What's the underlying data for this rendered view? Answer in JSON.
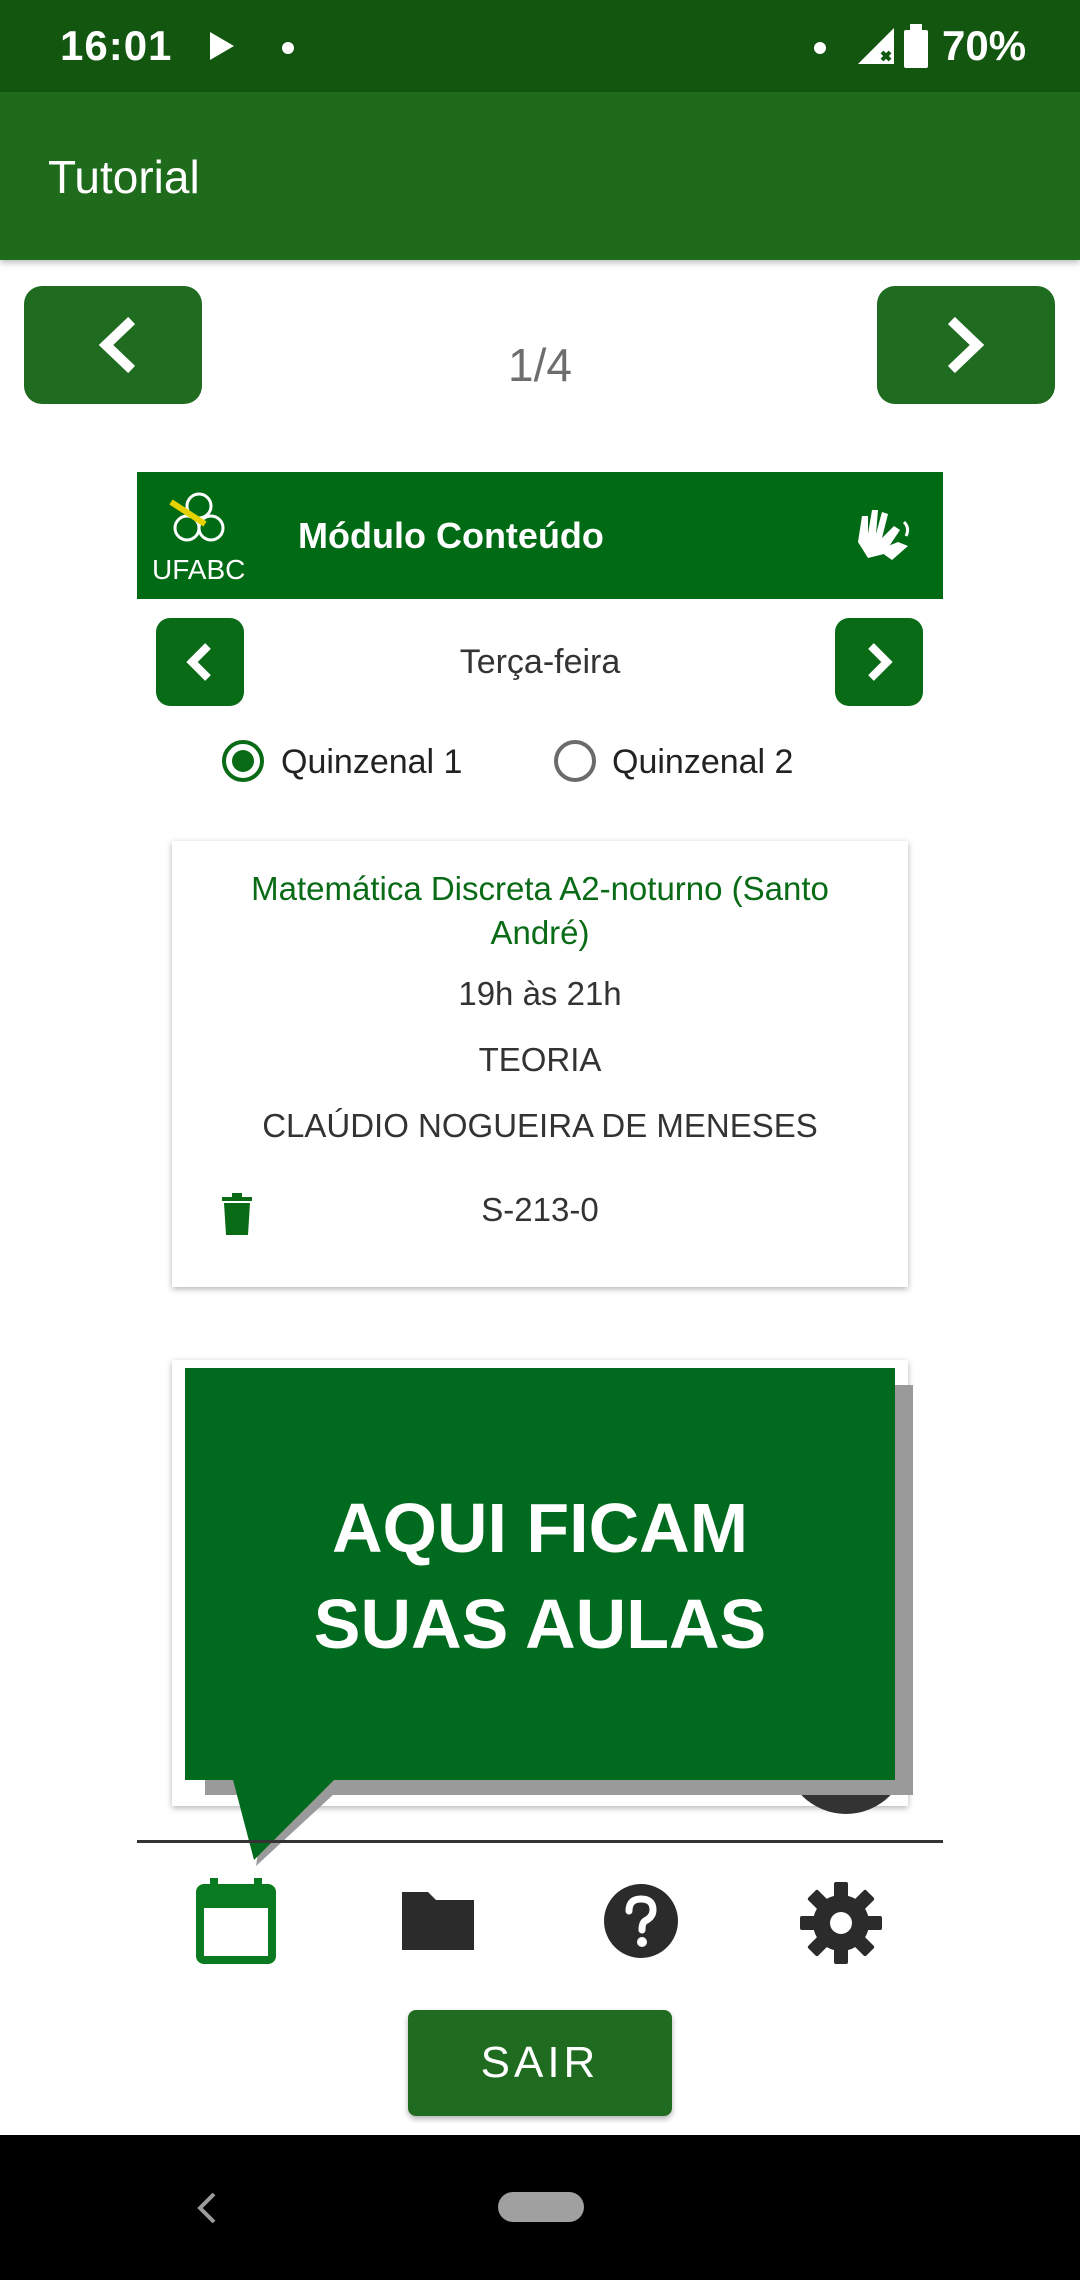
{
  "status_bar": {
    "time": "16:01",
    "battery": "70%"
  },
  "app_bar": {
    "title": "Tutorial"
  },
  "tutorial": {
    "page_counter": "1/4"
  },
  "module": {
    "logo_text": "UFABC",
    "title": "Módulo Conteúdo"
  },
  "day_selector": {
    "label": "Terça-feira"
  },
  "frequency": {
    "option1": "Quinzenal 1",
    "option2": "Quinzenal 2",
    "selected": "Quinzenal 1"
  },
  "class_card": {
    "title": "Matemática Discreta A2-noturno (Santo André)",
    "time": "19h às 21h",
    "type": "TEORIA",
    "teacher": "CLAÚDIO NOGUEIRA DE MENESES",
    "room": "S-213-0"
  },
  "tooltip": {
    "line1": "AQUI FICAM",
    "line2": "SUAS AULAS"
  },
  "bottom_nav": {
    "active": "calendar",
    "items": [
      "calendar-icon",
      "folder-icon",
      "help-icon",
      "settings-icon"
    ]
  },
  "exit_button": {
    "label": "SAIR"
  },
  "colors": {
    "primary": "#1e6b1c",
    "status_bar": "#12560f",
    "module_green": "#006b14"
  }
}
